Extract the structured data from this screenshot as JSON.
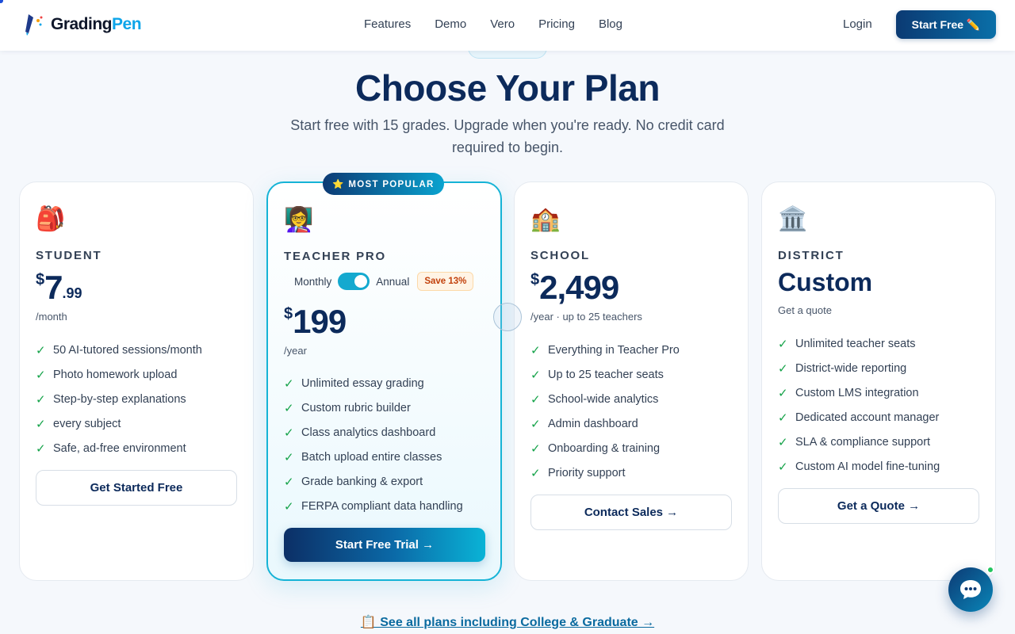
{
  "header": {
    "logo_part1": "Grading",
    "logo_part2": "Pen",
    "nav": [
      "Features",
      "Demo",
      "Vero",
      "Pricing",
      "Blog"
    ],
    "login": "Login",
    "start_free": "Start Free ✏️"
  },
  "hero": {
    "title": "Choose Your Plan",
    "subtitle": "Start free with 15 grades. Upgrade when you're ready. No credit card required to begin."
  },
  "plans": [
    {
      "icon": "🎒",
      "tier": "STUDENT",
      "currency": "$",
      "price": "7",
      "cents": ".99",
      "period": "/month",
      "features": [
        "50 AI-tutored sessions/month",
        "Photo homework upload",
        "Step-by-step explanations",
        "every subject",
        "Safe, ad-free environment"
      ],
      "cta": "Get Started Free"
    },
    {
      "badge": "⭐ MOST POPULAR",
      "icon": "👩‍🏫",
      "tier": "TEACHER PRO",
      "toggle_monthly": "Monthly",
      "toggle_annual": "Annual",
      "save": "Save 13%",
      "currency": "$",
      "price": "199",
      "period": "/year",
      "features": [
        "Unlimited essay grading",
        "Custom rubric builder",
        "Class analytics dashboard",
        "Batch upload entire classes",
        "Grade banking & export",
        "FERPA compliant data handling"
      ],
      "cta": "Start Free Trial →"
    },
    {
      "icon": "🏫",
      "tier": "SCHOOL",
      "currency": "$",
      "price": "2,499",
      "period": "/year · up to 25 teachers",
      "features": [
        "Everything in Teacher Pro",
        "Up to 25 teacher seats",
        "School-wide analytics",
        "Admin dashboard",
        "Onboarding & training",
        "Priority support"
      ],
      "cta": "Contact Sales →"
    },
    {
      "icon": "🏛️",
      "tier": "DISTRICT",
      "price_text": "Custom",
      "period": "Get a quote",
      "features": [
        "Unlimited teacher seats",
        "District-wide reporting",
        "Custom LMS integration",
        "Dedicated account manager",
        "SLA & compliance support",
        "Custom AI model fine-tuning"
      ],
      "cta": "Get a Quote →"
    }
  ],
  "bottom_link": "📋 See all plans including College & Graduate →",
  "colors": {
    "brand_navy": "#0c2a5b",
    "brand_cyan": "#0ea5e9",
    "check_green": "#16a34a",
    "popular_border": "#15b3d6"
  },
  "icons": {
    "chat": "chat-bubble-icon",
    "check": "check-icon"
  }
}
